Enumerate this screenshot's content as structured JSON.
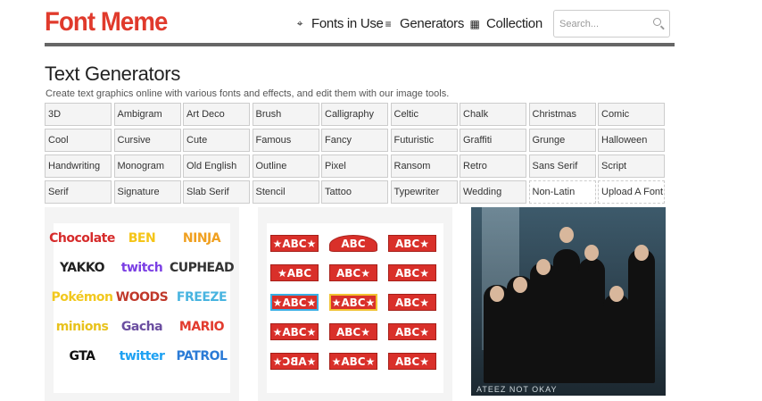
{
  "header": {
    "logo": "Font Meme",
    "nav": [
      {
        "label": "Fonts in Use",
        "icon": "crosshair-icon"
      },
      {
        "label": "Generators",
        "icon": "edit-list-icon"
      },
      {
        "label": "Collection",
        "icon": "grid-icon"
      }
    ],
    "search_placeholder": "Search..."
  },
  "main": {
    "title": "Text Generators",
    "subtitle": "Create text graphics online with various fonts and effects, and edit them with our image tools.",
    "categories": [
      "3D",
      "Ambigram",
      "Art Deco",
      "Brush",
      "Calligraphy",
      "Celtic",
      "Chalk",
      "Christmas",
      "Comic",
      "Cool",
      "Cursive",
      "Cute",
      "Famous",
      "Fancy",
      "Futuristic",
      "Graffiti",
      "Grunge",
      "Halloween",
      "Handwriting",
      "Monogram",
      "Old English",
      "Outline",
      "Pixel",
      "Ransom",
      "Retro",
      "Sans Serif",
      "Script",
      "Serif",
      "Signature",
      "Slab Serif",
      "Stencil",
      "Tattoo",
      "Typewriter",
      "Wedding",
      "Non-Latin",
      "Upload A Font"
    ]
  },
  "panels": {
    "famous_logos": [
      {
        "text": "Chocolate",
        "color": "#d62b2b"
      },
      {
        "text": "BEN",
        "color": "#f5c518"
      },
      {
        "text": "NINJA",
        "color": "#f0a020"
      },
      {
        "text": "YAKKO",
        "color": "#222222"
      },
      {
        "text": "twitch",
        "color": "#7b3fe4"
      },
      {
        "text": "CUPHEAD",
        "color": "#333333"
      },
      {
        "text": "Pokémon",
        "color": "#f2c81e"
      },
      {
        "text": "WOODS",
        "color": "#c0392b"
      },
      {
        "text": "FREEZE",
        "color": "#48b4e0"
      },
      {
        "text": "minions",
        "color": "#e8c21c"
      },
      {
        "text": "Gacha",
        "color": "#6b4ea0"
      },
      {
        "text": "MARIO",
        "color": "#e23b2e"
      },
      {
        "text": "GTA",
        "color": "#111111"
      },
      {
        "text": "twitter",
        "color": "#1da1f2"
      },
      {
        "text": "PATROL",
        "color": "#2b7bd6"
      }
    ],
    "abc_badges": [
      "★ABC★",
      "ABC",
      "ABC★",
      "★ABC",
      "ABC★",
      "ABC★",
      "★ABC★",
      "★ABC★",
      "ABC★",
      "★ABC★",
      "ABC★",
      "ABC★",
      "★ABC★",
      "★ABC★",
      "ABC★"
    ],
    "photo_caption": "ATEEZ  NOT OKAY"
  }
}
